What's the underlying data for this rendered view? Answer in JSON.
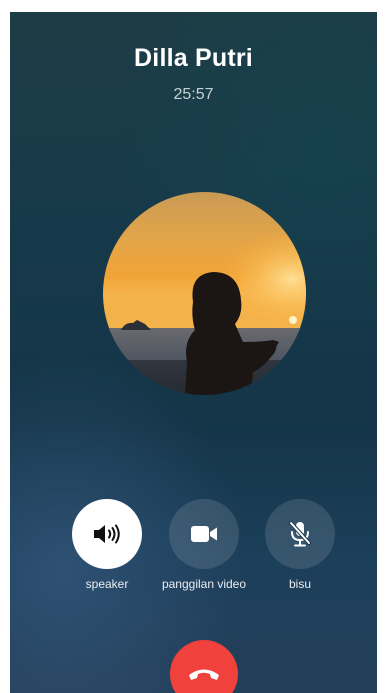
{
  "call": {
    "caller_name": "Dilla Putri",
    "duration": "25:57"
  },
  "avatar": {
    "icon": "profile-photo-sunset-silhouette"
  },
  "controls": {
    "speaker": {
      "label": "speaker",
      "icon": "speaker-icon",
      "active": true
    },
    "video": {
      "label": "panggilan video",
      "icon": "video-camera-icon",
      "active": false
    },
    "mute": {
      "label": "bisu",
      "icon": "microphone-muted-icon",
      "active": false
    }
  },
  "end_call": {
    "icon": "end-call-icon",
    "color": "#f0413c"
  },
  "colors": {
    "background_top": "#1d3d46",
    "background_bottom": "#243f59",
    "end_call_red": "#f0413c"
  }
}
